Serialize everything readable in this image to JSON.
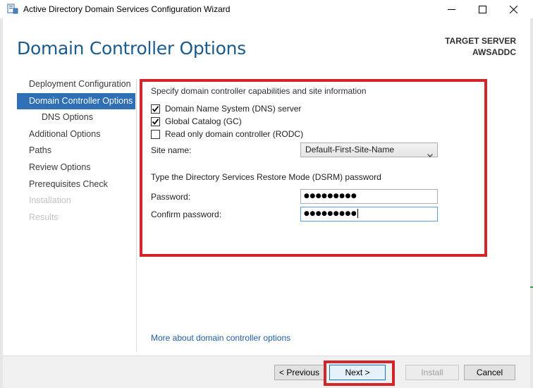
{
  "window": {
    "title": "Active Directory Domain Services Configuration Wizard",
    "controls": [
      "minimize-icon",
      "maximize-icon",
      "close-icon"
    ]
  },
  "header": {
    "page_title": "Domain Controller Options",
    "target_label": "TARGET SERVER",
    "target_name": "AWSADDC"
  },
  "nav": {
    "items": [
      {
        "label": "Deployment Configuration",
        "state": "normal"
      },
      {
        "label": "Domain Controller Options",
        "state": "active"
      },
      {
        "label": "DNS Options",
        "state": "sub"
      },
      {
        "label": "Additional Options",
        "state": "normal"
      },
      {
        "label": "Paths",
        "state": "normal"
      },
      {
        "label": "Review Options",
        "state": "normal"
      },
      {
        "label": "Prerequisites Check",
        "state": "normal"
      },
      {
        "label": "Installation",
        "state": "disabled"
      },
      {
        "label": "Results",
        "state": "disabled"
      }
    ]
  },
  "main": {
    "capabilities_heading": "Specify domain controller capabilities and site information",
    "checkboxes": [
      {
        "label": "Domain Name System (DNS) server",
        "checked": true
      },
      {
        "label": "Global Catalog (GC)",
        "checked": true
      },
      {
        "label": "Read only domain controller (RODC)",
        "checked": false
      }
    ],
    "site_name_label": "Site name:",
    "site_name_value": "Default-First-Site-Name",
    "dsrm_heading": "Type the Directory Services Restore Mode (DSRM) password",
    "password_label": "Password:",
    "password_value": "●●●●●●●●●",
    "confirm_label": "Confirm password:",
    "confirm_value": "●●●●●●●●●",
    "more_link": "More about domain controller options"
  },
  "footer": {
    "previous_label": "< Previous",
    "next_label": "Next >",
    "install_label": "Install",
    "cancel_label": "Cancel"
  },
  "colors": {
    "accent": "#2f6fb5",
    "title_blue": "#1a5c8f",
    "annotation_red": "#d3262c",
    "link": "#1c5ea6"
  }
}
